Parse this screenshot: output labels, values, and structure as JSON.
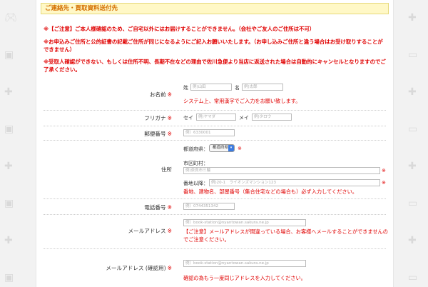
{
  "section_title": "ご連絡先・買取資料送付先",
  "notices": [
    "※【ご注意】ご本人様確認のため、ご自宅以外にはお届けすることができません。（会社やご友人のご住所は不可）",
    "※お申込みご住所と公的証書の記載ご住所が同じになるようにご記入お願いいたします。（お申し込みご住所と違う場合はお受け取りすることができません）",
    "※受取人確認ができない、もしくは住所不明、長期不在などの理由で佐川急便より当店に返送された場合は自動的にキャンセルとなりますのでご了承ください。"
  ],
  "required_mark": "※",
  "form": {
    "name": {
      "label": "お名前",
      "sei_label": "姓",
      "sei_placeholder": "例)山田",
      "mei_label": "名",
      "mei_placeholder": "例)太郎",
      "note": "システム上、常用漢字でご入力をお願い致します。"
    },
    "furigana": {
      "label": "フリガナ",
      "sei_label": "セイ",
      "sei_placeholder": "例)ヤマダ",
      "mei_label": "メイ",
      "mei_placeholder": "例)タロウ"
    },
    "postal": {
      "label": "郵便番号",
      "placeholder": "例）6330001"
    },
    "address": {
      "label": "住所",
      "prefecture_label": "都道府県：",
      "prefecture_value": "都道府県",
      "city_label": "市区町村：",
      "city_placeholder": "例)奈良市三輪",
      "street_label": "番地以降：",
      "street_placeholder": "例)20-1　ライオンズマンション123",
      "note": "番地、建物名、部屋番号（集合住宅などの場合も）必ず入力してください。"
    },
    "phone": {
      "label": "電話番号",
      "placeholder": "例）0744351342"
    },
    "email": {
      "label": "メールアドレス",
      "placeholder": "例）book-station@nyantowan.sakura.ne.jp",
      "note_line1": "【ご注意】メールアドレスが間違っている場合、お客様へメールすることができませんの",
      "note_line2": "でご注意ください。"
    },
    "email_confirm": {
      "label": "メールアドレス (確認用)",
      "placeholder": "例）book-station@nyantowan.sakura.ne.jp",
      "note": "確認の為もう一度同じアドレスを入力してください。"
    }
  },
  "bg_icons": [
    "game-controller",
    "handheld-console",
    "book",
    "monitor"
  ]
}
